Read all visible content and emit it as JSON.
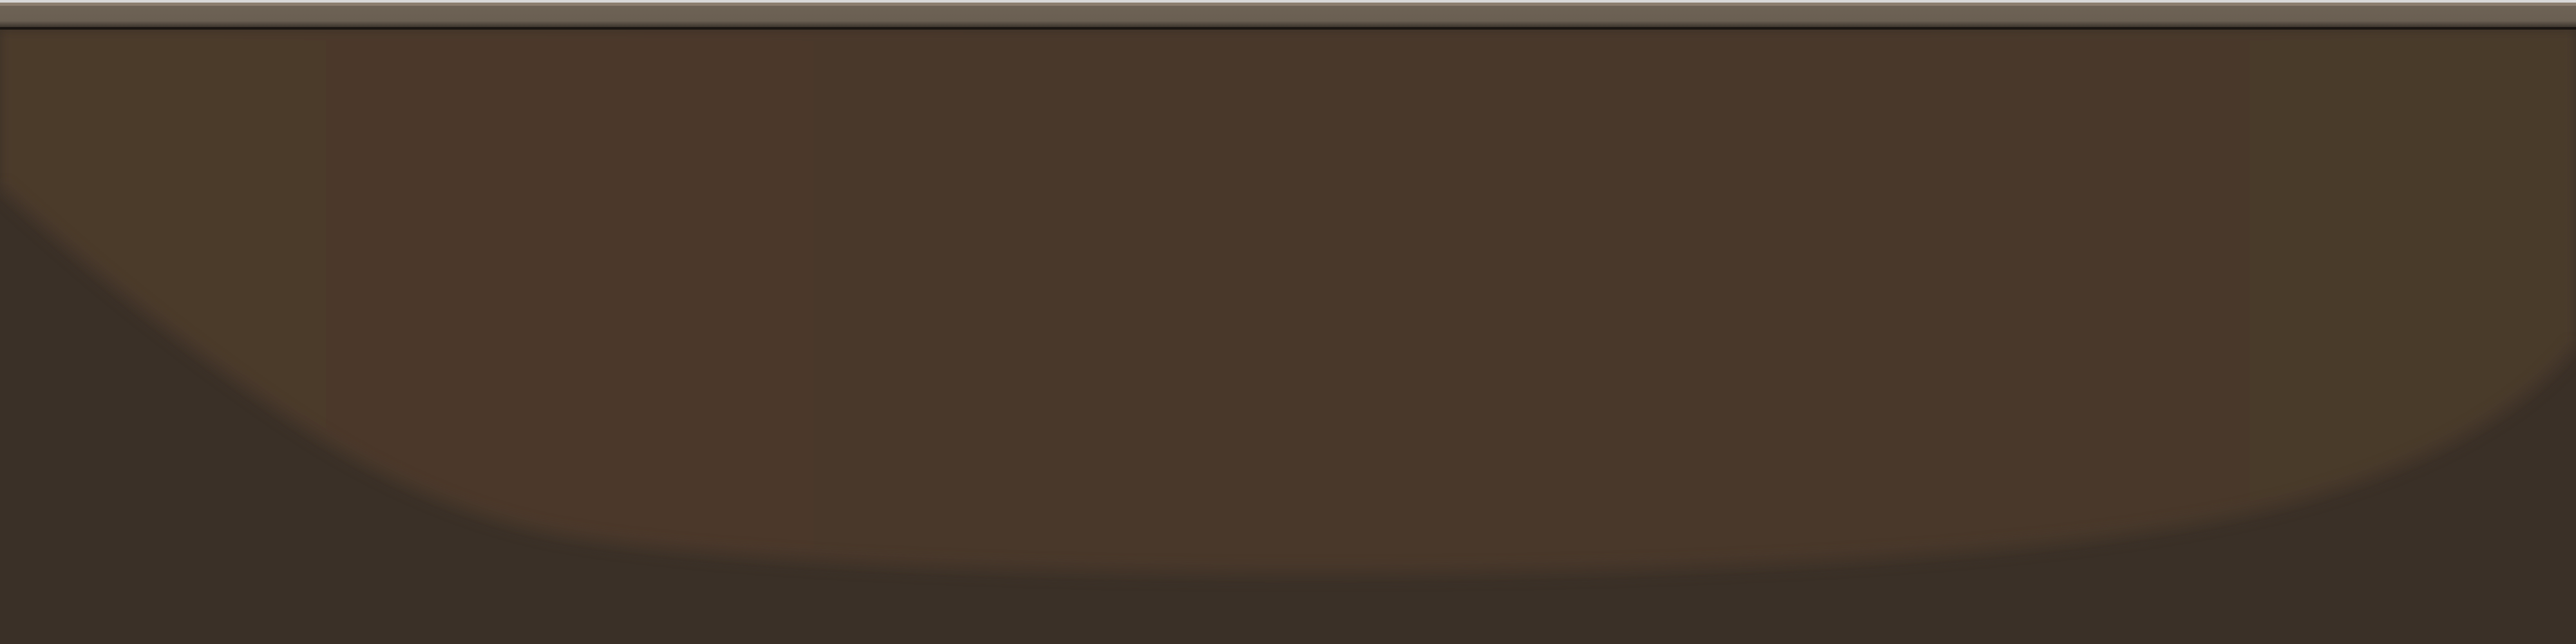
{
  "window": {
    "title": ""
  },
  "colors": {
    "rim_top": "#6f6457",
    "rim_highlight": "#8b7d6e",
    "rim_shadow": "#1a1612",
    "upper_field": "#4b3a2b",
    "lower_field": "#3a3027"
  },
  "scene": {
    "description_label": ""
  }
}
